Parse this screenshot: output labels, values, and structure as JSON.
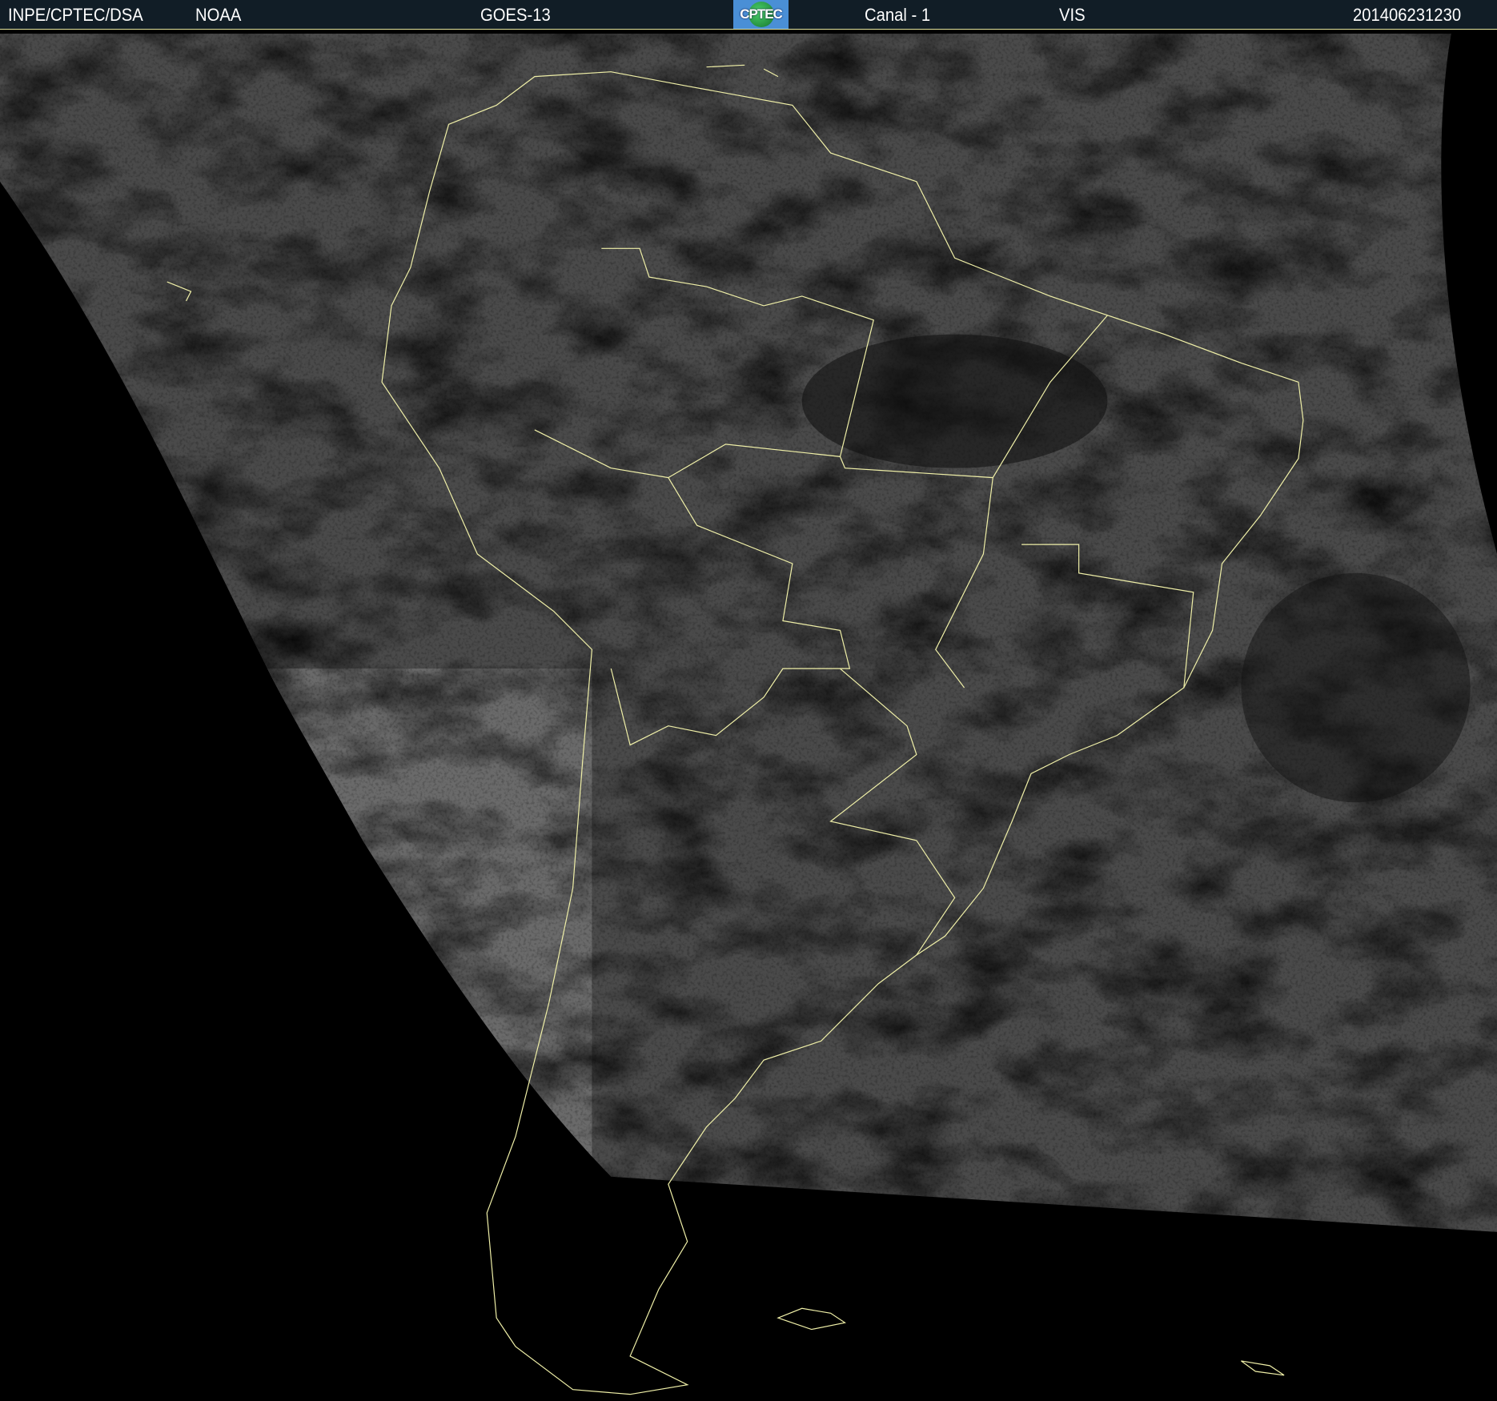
{
  "header": {
    "agency": "INPE/CPTEC/DSA",
    "source": "NOAA",
    "satellite": "GOES-13",
    "logo_text": "CPTEC",
    "channel": "Canal - 1",
    "band": "VIS",
    "timestamp": "201406231230"
  },
  "colors": {
    "header_bg": "#111d26",
    "coastline": "#f0f0a8",
    "background": "#000000"
  }
}
